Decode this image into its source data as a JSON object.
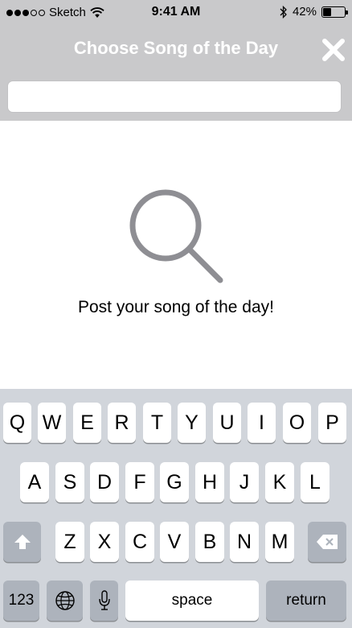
{
  "status_bar": {
    "carrier": "Sketch",
    "time": "9:41 AM",
    "battery_percent": "42%",
    "battery_level": 0.42,
    "signal_dots": [
      true,
      true,
      true,
      false,
      false
    ]
  },
  "nav": {
    "title": "Choose Song of the Day",
    "close_icon": "close-icon"
  },
  "search": {
    "value": "",
    "placeholder": ""
  },
  "empty_state": {
    "icon": "magnifier-icon",
    "message": "Post your song of the day!"
  },
  "keyboard": {
    "row1": [
      "Q",
      "W",
      "E",
      "R",
      "T",
      "Y",
      "U",
      "I",
      "O",
      "P"
    ],
    "row2": [
      "A",
      "S",
      "D",
      "F",
      "G",
      "H",
      "J",
      "K",
      "L"
    ],
    "row3": [
      "Z",
      "X",
      "C",
      "V",
      "B",
      "N",
      "M"
    ],
    "numbers_label": "123",
    "space_label": "space",
    "return_label": "return",
    "icons": [
      "shift-icon",
      "backspace-icon",
      "globe-icon",
      "microphone-icon"
    ]
  },
  "colors": {
    "chrome_gray": "#c9c9cb",
    "keyboard_bg": "#d1d5db",
    "dark_key": "#adb3bc",
    "icon_gray": "#8e8e93"
  }
}
